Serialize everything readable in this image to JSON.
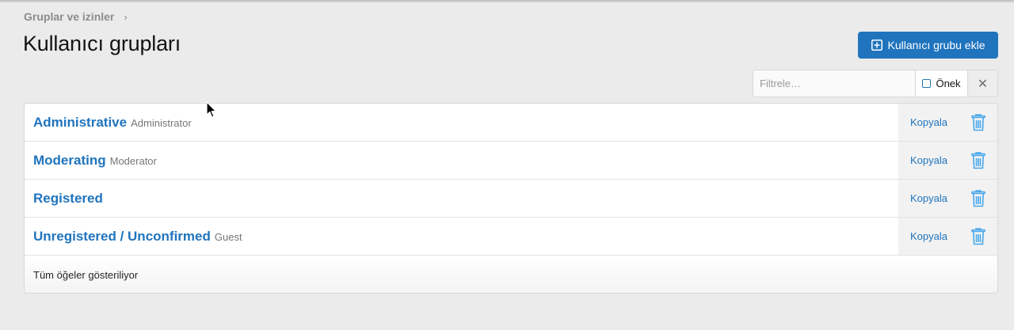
{
  "breadcrumb": {
    "label": "Gruplar ve izinler",
    "separator": "›"
  },
  "page": {
    "title": "Kullanıcı grupları"
  },
  "toolbar": {
    "add_label": "Kullanıcı grubu ekle",
    "add_icon": "plus-square-icon"
  },
  "filter": {
    "placeholder": "Filtrele…",
    "value": "",
    "prefix_label": "Önek",
    "prefix_checked": false,
    "clear_icon": "close-icon",
    "clear_glyph": "✕"
  },
  "groups": [
    {
      "title": "Administrative",
      "hint": "Administrator",
      "copy_label": "Kopyala"
    },
    {
      "title": "Moderating",
      "hint": "Moderator",
      "copy_label": "Kopyala"
    },
    {
      "title": "Registered",
      "hint": "",
      "copy_label": "Kopyala"
    },
    {
      "title": "Unregistered / Unconfirmed",
      "hint": "Guest",
      "copy_label": "Kopyala"
    }
  ],
  "footer": {
    "status": "Tüm öğeler gösteriliyor"
  },
  "colors": {
    "accent": "#1f74bd",
    "background": "#ebebeb",
    "delete_icon": "#47a7eb"
  }
}
